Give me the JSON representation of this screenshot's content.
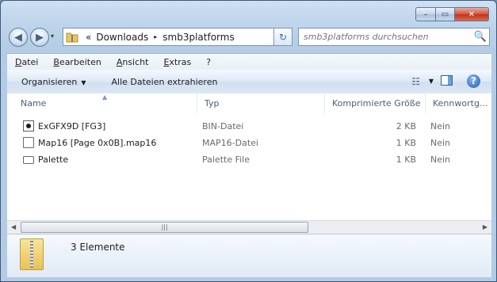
{
  "window": {
    "minimize_glyph": "–",
    "maximize_glyph": "▭",
    "close_glyph": "✕"
  },
  "nav": {
    "back_glyph": "◀",
    "forward_glyph": "▶",
    "dropdown_glyph": "▾"
  },
  "address": {
    "prefix": "«",
    "crumbs": [
      "Downloads",
      "smb3platforms"
    ],
    "separator_glyph": "▸",
    "dropdown_glyph": "▼"
  },
  "refresh_glyph": "↻",
  "search": {
    "placeholder": "smb3platforms durchsuchen",
    "icon_glyph": "🔍"
  },
  "menubar": {
    "items": [
      "Datei",
      "Bearbeiten",
      "Ansicht",
      "Extras",
      "?"
    ]
  },
  "commandbar": {
    "organize_label": "Organisieren",
    "organize_arrow": "▼",
    "extract_label": "Alle Dateien extrahieren",
    "views_glyph": "☷",
    "views_dropdown": "▼",
    "help_glyph": "?"
  },
  "columns": {
    "name": "Name",
    "type": "Typ",
    "compressed_size": "Komprimierte Größe",
    "password": "Kennwortg..."
  },
  "sort_indicator": "▲",
  "files": [
    {
      "name": "ExGFX9D [FG3]",
      "type": "BIN-Datei",
      "size": "2 KB",
      "password": "Nein",
      "icon": "bin-file-icon"
    },
    {
      "name": "Map16 [Page 0x0B].map16",
      "type": "MAP16-Datei",
      "size": "1 KB",
      "password": "Nein",
      "icon": "document-icon"
    },
    {
      "name": "Palette",
      "type": "Palette File",
      "size": "1 KB",
      "password": "Nein",
      "icon": "palette-file-icon"
    }
  ],
  "scrollbar": {
    "left_arrow": "◀",
    "right_arrow": "▶",
    "grip": "|||"
  },
  "details": {
    "item_count": "3 Elemente"
  }
}
